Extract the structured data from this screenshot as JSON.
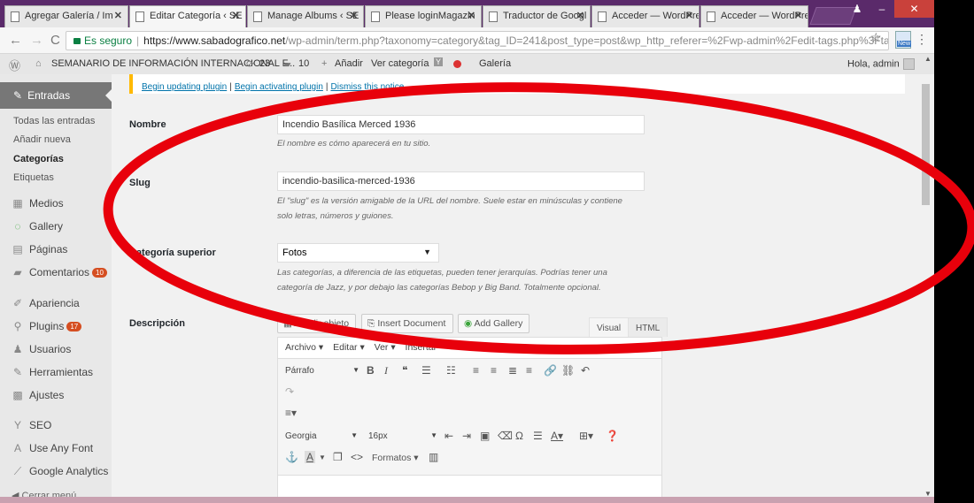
{
  "browser": {
    "tabs": [
      {
        "title": "Agregar Galería / Im"
      },
      {
        "title": "Editar Categoría ‹ SE"
      },
      {
        "title": "Manage Albums ‹ SE"
      },
      {
        "title": "Please loginMagazin"
      },
      {
        "title": "Traductor de Googl"
      },
      {
        "title": "Acceder — WordPre"
      },
      {
        "title": "Acceder — WordPre"
      }
    ],
    "secure_label": "Es seguro",
    "url_host": "https://www.sabadografico.net",
    "url_path": "/wp-admin/term.php?taxonomy=category&tag_ID=241&post_type=post&wp_http_referer=%2Fwp-admin%2Fedit-tags.php%3Ftaxonomy%...",
    "ext_badge": "New"
  },
  "adminbar": {
    "site_name": "SEMANARIO DE INFORMACIÓN INTERNACIONAL F...",
    "updates": "23",
    "comments": "10",
    "add": "Añadir",
    "view_category": "Ver categoría",
    "gallery": "Galería",
    "greeting": "Hola, admin"
  },
  "sidebar": {
    "current": "Entradas",
    "subitems": [
      "Todas las entradas",
      "Añadir nueva",
      "Categorías",
      "Etiquetas"
    ],
    "items": [
      {
        "label": "Medios",
        "icon": "media-icon"
      },
      {
        "label": "Gallery",
        "icon": "gallery-icon"
      },
      {
        "label": "Páginas",
        "icon": "pages-icon"
      },
      {
        "label": "Comentarios",
        "icon": "comments-icon",
        "badge": "10"
      },
      {
        "label": "Apariencia",
        "icon": "appearance-icon"
      },
      {
        "label": "Plugins",
        "icon": "plugins-icon",
        "badge": "17"
      },
      {
        "label": "Usuarios",
        "icon": "users-icon"
      },
      {
        "label": "Herramientas",
        "icon": "tools-icon"
      },
      {
        "label": "Ajustes",
        "icon": "settings-icon"
      },
      {
        "label": "SEO",
        "icon": "seo-icon"
      },
      {
        "label": "Use Any Font",
        "icon": "font-icon"
      },
      {
        "label": "Google Analytics",
        "icon": "analytics-icon"
      }
    ],
    "collapse": "Cerrar menú"
  },
  "notice": {
    "link1": "Begin updating plugin",
    "link2": "Begin activating plugin",
    "link3": "Dismiss this notice"
  },
  "form": {
    "name_label": "Nombre",
    "name_value": "Incendio Basílica Merced 1936",
    "name_desc": "El nombre es cómo aparecerá en tu sitio.",
    "slug_label": "Slug",
    "slug_value": "incendio-basilica-merced-1936",
    "slug_desc1": "El \"slug\" es la versión amigable de la URL del nombre. Suele estar en minúsculas y contiene",
    "slug_desc2": "solo letras, números y guiones.",
    "parent_label": "Categoría superior",
    "parent_value": "Fotos",
    "parent_desc1": "Las categorías, a diferencia de las etiquetas, pueden tener jerarquías. Podrías tener una",
    "parent_desc2": "categoría de Jazz, y por debajo las categorías Bebop y Big Band. Totalmente opcional.",
    "desc_label": "Descripción"
  },
  "editor": {
    "add_media": "Añadir objeto",
    "insert_document": "Insert Document",
    "add_gallery": "Add Gallery",
    "tab_visual": "Visual",
    "tab_html": "HTML",
    "menu": [
      "Archivo ▾",
      "Editar ▾",
      "Ver ▾",
      "Insertar"
    ],
    "format_select": "Párrafo",
    "font_select": "Georgia",
    "size_select": "16px",
    "formats": "Formatos ▾"
  },
  "annotation_color": "#e8000b"
}
